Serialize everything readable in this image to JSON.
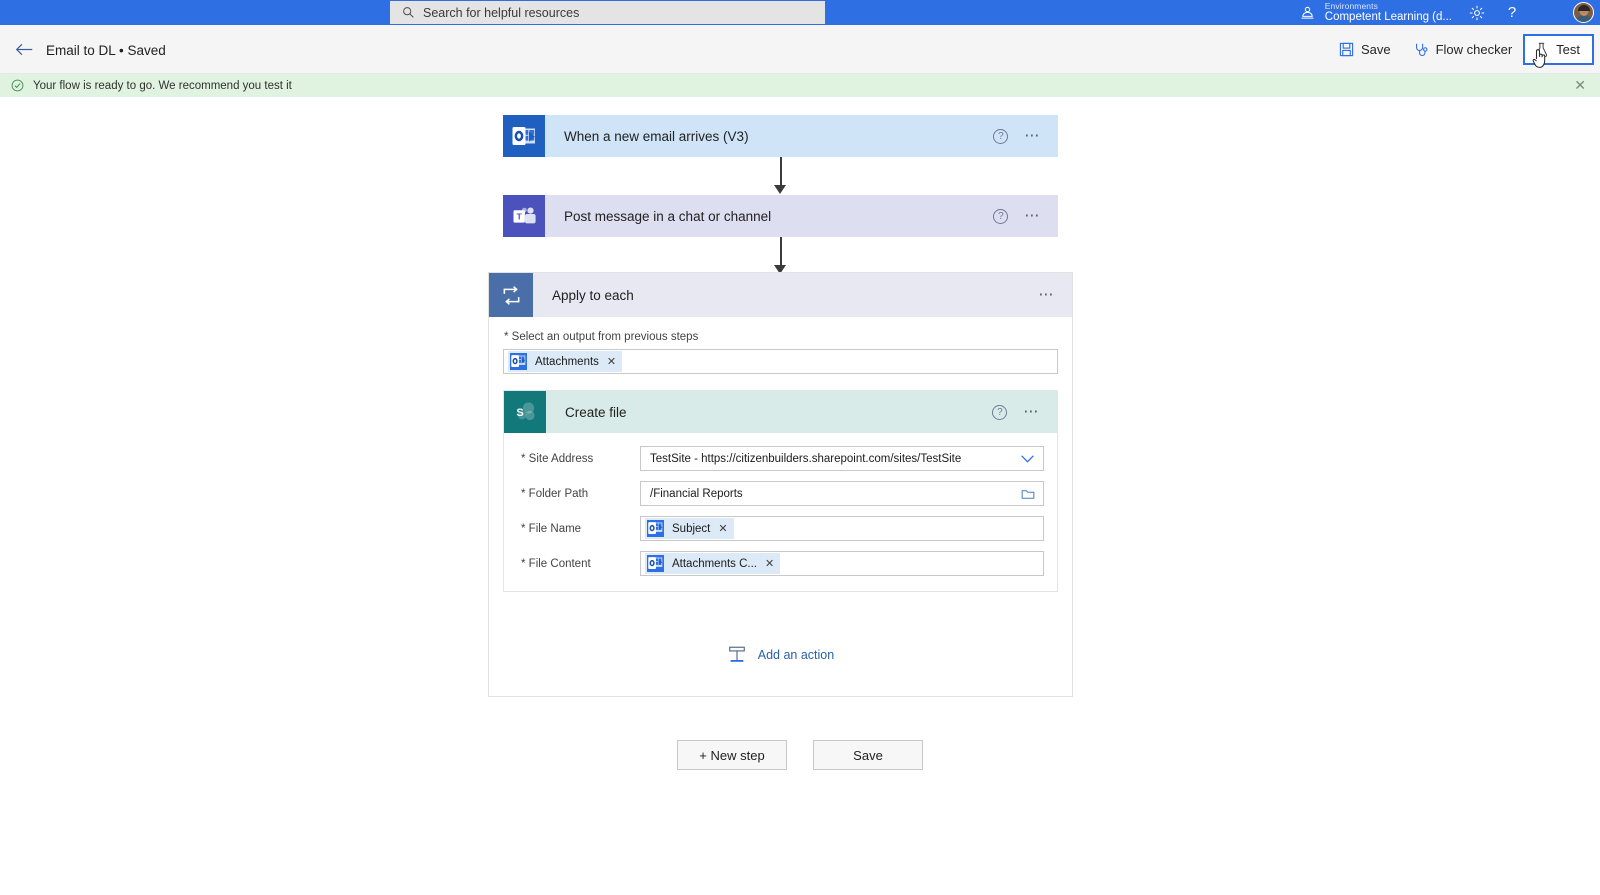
{
  "header": {
    "search": {
      "placeholder": "Search for helpful resources",
      "icon": "search-icon"
    },
    "environment_label": "Environments",
    "environment_name": "Competent Learning (d...",
    "environment_icon": "environment-icon",
    "settings_icon": "gear-icon",
    "help_icon": "help-icon",
    "avatar_name": "user-avatar",
    "brand_color": "#2f6fe4"
  },
  "commandbar": {
    "back_icon": "back-arrow-icon",
    "flow_title": "Email to DL • Saved",
    "save_label": "Save",
    "save_icon": "save-icon",
    "flow_checker_label": "Flow checker",
    "flow_checker_icon": "stethoscope-icon",
    "test_label": "Test",
    "test_icon": "flask-icon"
  },
  "notification": {
    "icon": "check-circle-icon",
    "message": "Your flow is ready to go. We recommend you test it",
    "close_label": "✕",
    "background": "#dff3e0"
  },
  "flow": {
    "trigger": {
      "title": "When a new email arrives (V3)",
      "icon": "outlook-icon",
      "help_icon": "help-circle-icon",
      "menu_icon": "ellipsis-icon",
      "color": "#cfe4f7"
    },
    "action_teams": {
      "title": "Post message in a chat or channel",
      "icon": "teams-icon",
      "help_icon": "help-circle-icon",
      "menu_icon": "ellipsis-icon",
      "color": "#dddef0"
    },
    "apply_to_each": {
      "title": "Apply to each",
      "icon": "loop-icon",
      "menu_icon": "ellipsis-icon",
      "output_label": "* Select an output from previous steps",
      "output_token": "Attachments",
      "output_token_icon": "outlook-icon",
      "token_remove": "✕"
    },
    "create_file": {
      "title": "Create file",
      "icon": "sharepoint-icon",
      "help_icon": "help-circle-icon",
      "menu_icon": "ellipsis-icon",
      "fields": [
        {
          "label": "* Site Address",
          "type": "dropdown",
          "value": "TestSite - https://citizenbuilders.sharepoint.com/sites/TestSite",
          "trailing_icon": "chevron-down-icon"
        },
        {
          "label": "* Folder Path",
          "type": "text",
          "value": "/Financial Reports",
          "trailing_icon": "folder-picker-icon"
        },
        {
          "label": "* File Name",
          "type": "token",
          "value": "Subject",
          "token_icon": "outlook-icon",
          "token_remove": "✕"
        },
        {
          "label": "* File Content",
          "type": "token",
          "value": "Attachments C...",
          "token_icon": "outlook-icon",
          "token_remove": "✕"
        }
      ]
    },
    "add_action": {
      "label": "Add an action",
      "icon": "add-action-icon"
    }
  },
  "footer": {
    "new_step_label": "+ New step",
    "save_label": "Save"
  }
}
